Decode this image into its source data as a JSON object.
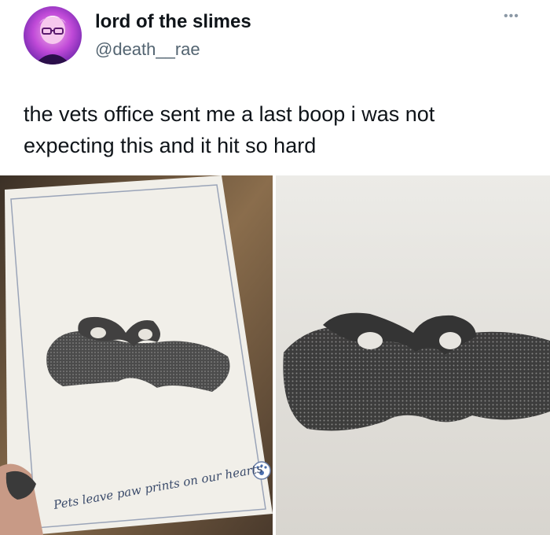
{
  "tweet": {
    "author": {
      "display_name": "lord of the slimes",
      "handle": "@death__rae",
      "avatar_icon": "avatar"
    },
    "more_icon": "ellipsis-icon",
    "text": "the vets office sent me a last boop i was not expecting this and it hit so hard"
  },
  "media": {
    "card_caption": "Pets leave paw prints on our hearts",
    "paw_icon": "paw-icon"
  }
}
